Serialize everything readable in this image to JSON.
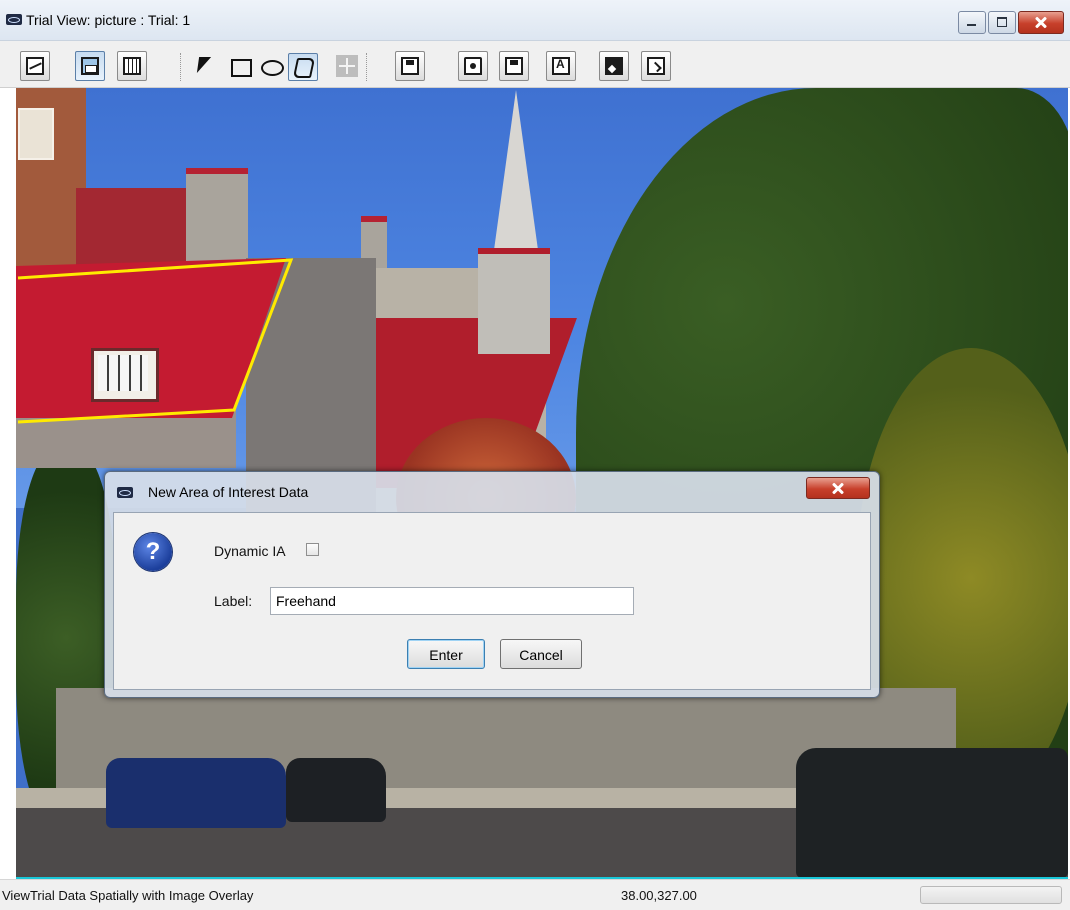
{
  "window": {
    "title": "Trial View: picture : Trial: 1",
    "app_icon": "eye-icon"
  },
  "toolbar": {
    "view_buttons": [
      {
        "icon": "line-chart-icon"
      },
      {
        "icon": "image-overlay-icon"
      },
      {
        "icon": "filmstrip-icon"
      }
    ],
    "shape_tools": [
      {
        "icon": "pointer-icon"
      },
      {
        "icon": "rectangle-icon"
      },
      {
        "icon": "ellipse-icon"
      },
      {
        "icon": "freehand-icon"
      },
      {
        "icon": "crosshair-icon"
      }
    ],
    "file_buttons": [
      {
        "icon": "save-icon"
      },
      {
        "icon": "load-ia-icon"
      },
      {
        "icon": "save-ia-icon"
      },
      {
        "icon": "text-icon"
      },
      {
        "icon": "image-icon"
      },
      {
        "icon": "export-icon"
      }
    ]
  },
  "dialog": {
    "title": "New Area of Interest Data",
    "icon": "help-question-icon",
    "dynamic_label": "Dynamic IA",
    "dynamic_checked": false,
    "label_label": "Label:",
    "label_value": "Freehand",
    "enter_label": "Enter",
    "cancel_label": "Cancel"
  },
  "status": {
    "left_text": "ViewTrial Data Spatially with Image Overlay",
    "coords": "38.00,327.00"
  },
  "colors": {
    "ia_outline": "#ffea00",
    "accent_border": "#19c7d8"
  }
}
